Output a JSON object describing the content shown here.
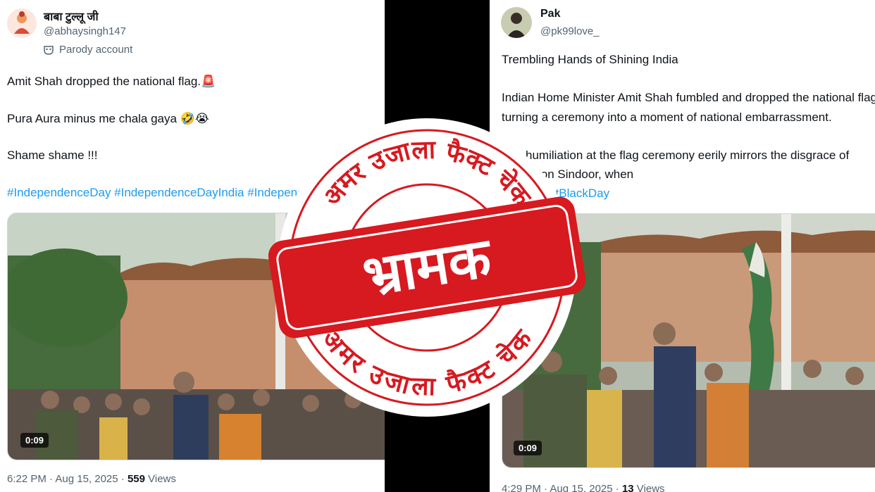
{
  "left_post": {
    "display_name": "बाबा टुल्लू जी",
    "handle": "@abhaysingh147",
    "parody_label": "Parody account",
    "lines": [
      "Amit Shah dropped the national flag.🚨",
      "Pura Aura minus me chala gaya 🤣😭",
      "Shame shame !!!"
    ],
    "hashtags": "#IndependenceDay #IndependenceDayIndia #IndependenceDay",
    "video_duration": "0:09",
    "timestamp": "6:22 PM · Aug 15, 2025 · ",
    "views_count": "559",
    "views_label": " Views"
  },
  "right_post": {
    "display_name": "Pak",
    "handle": "@pk99love_",
    "title_line": "Trembling Hands of Shining India",
    "body_lines": [
      "Indian Home Minister Amit Shah fumbled and dropped the national flag,",
      "turning a ceremony into a moment of national embarrassment.",
      "The humiliation at the flag ceremony eerily mirrors the disgrace of",
      "Operation Sindoor, when"
    ],
    "hashtags": "#15AugustBlackDay",
    "video_duration": "0:09",
    "timestamp": "4:29 PM · Aug 15, 2025 · ",
    "views_count": "13",
    "views_label": " Views"
  },
  "stamp": {
    "top_arc_text": "अमर उजाला फैक्ट चेक",
    "bottom_arc_text": "अमर उजाला फैक्ट चेक",
    "verdict": "भ्रामक",
    "color": "#d71920"
  },
  "colors": {
    "text_primary": "#0f1419",
    "text_secondary": "#536471",
    "link": "#1d9bf0",
    "divider": "#000000"
  },
  "icons": {
    "parody": "parody-mask-icon"
  }
}
